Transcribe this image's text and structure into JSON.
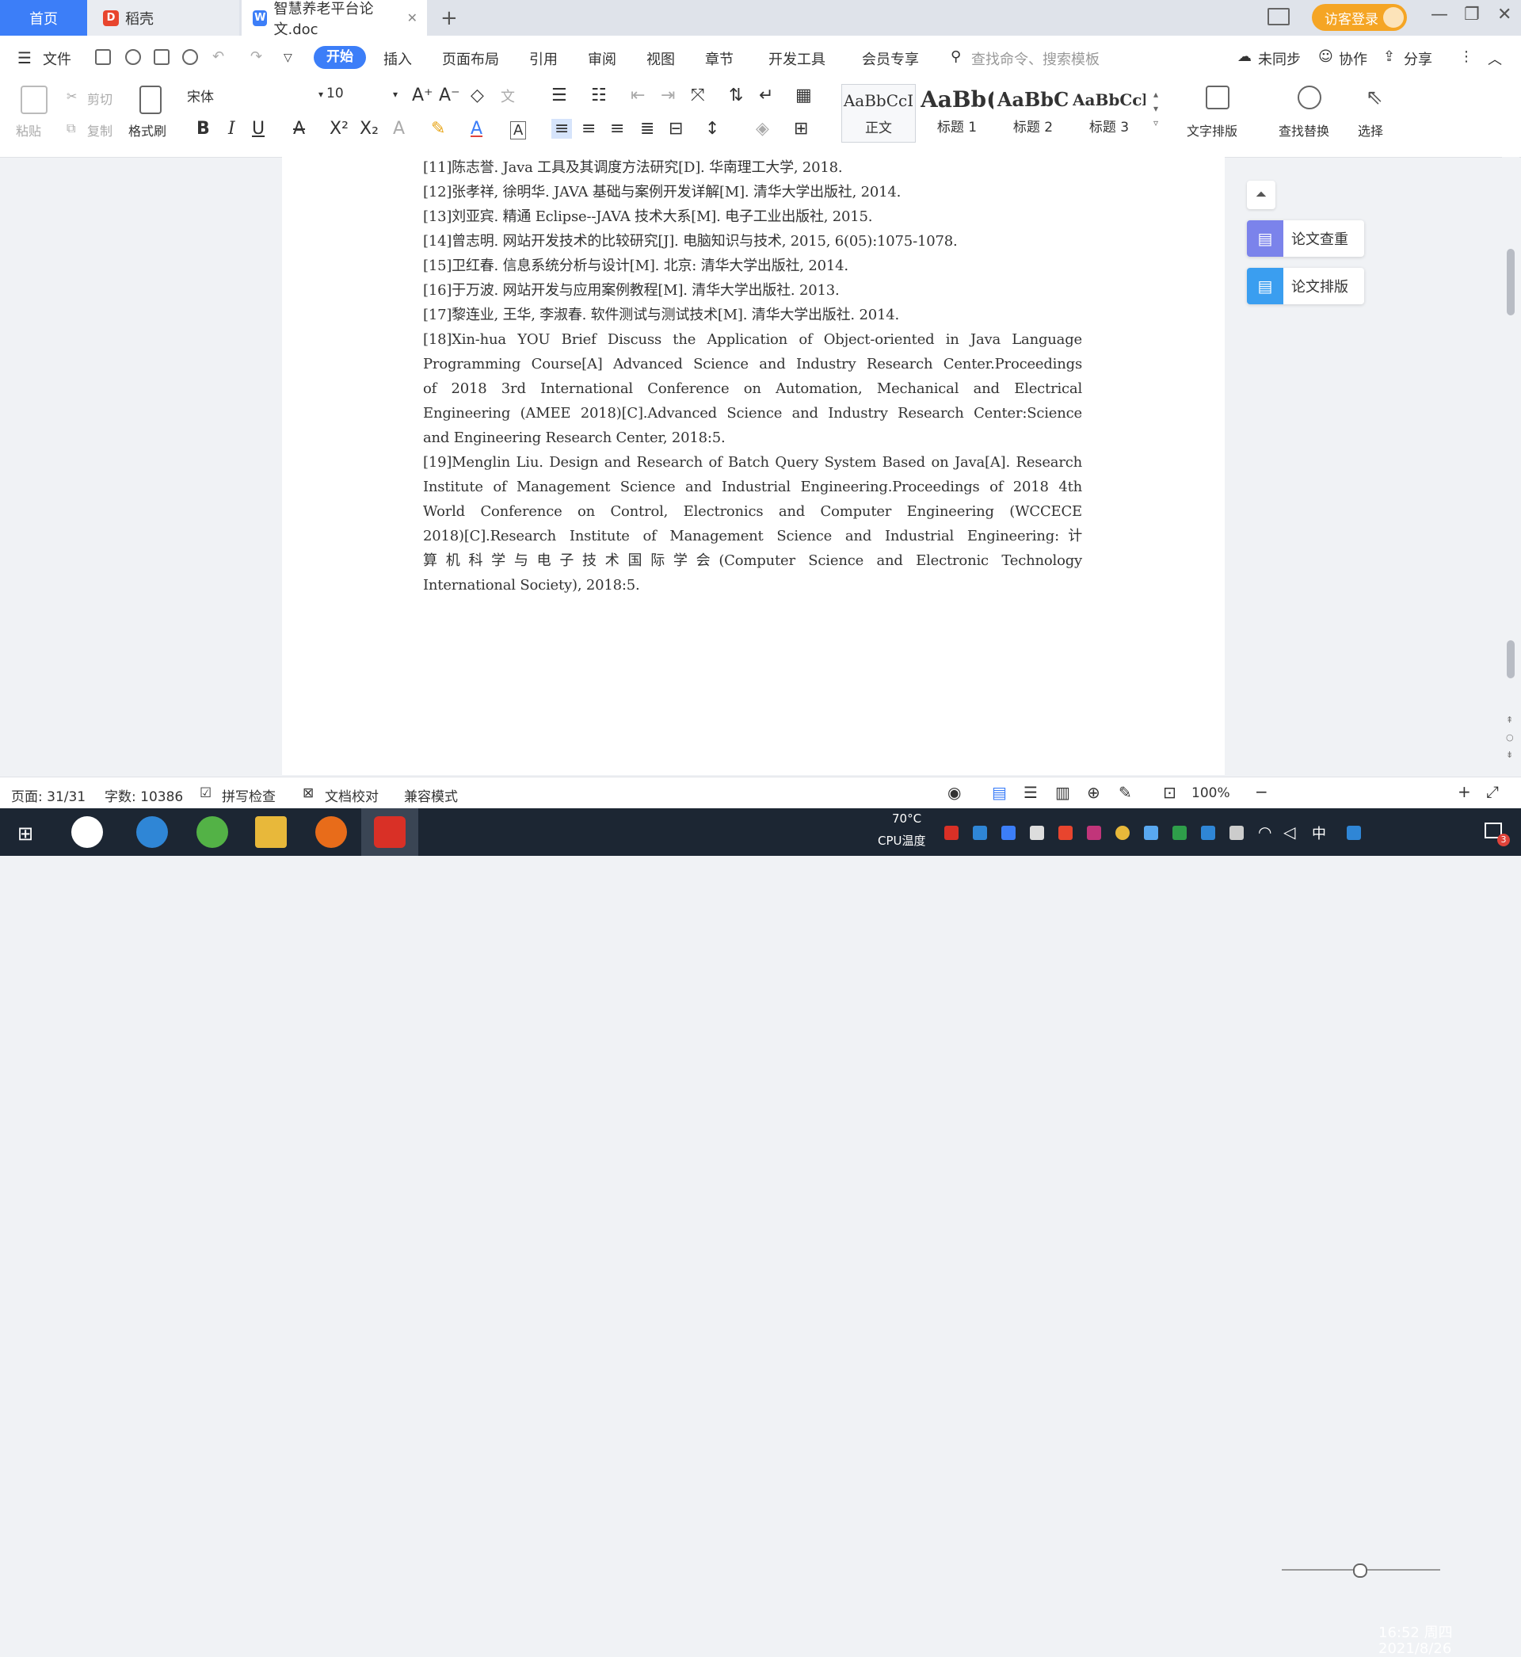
{
  "tabs": {
    "home": "首页",
    "daoke": "稻壳",
    "doc": "智慧养老平台论文.doc",
    "add": "+"
  },
  "header": {
    "visitor_login": "访客登录"
  },
  "menubar": {
    "file": "文件",
    "items": [
      "开始",
      "插入",
      "页面布局",
      "引用",
      "审阅",
      "视图",
      "章节",
      "开发工具",
      "会员专享"
    ],
    "search_placeholder": "查找命令、搜索模板",
    "unsync": "未同步",
    "collab": "协作",
    "share": "分享"
  },
  "ribbon": {
    "paste": "粘贴",
    "cut": "剪切",
    "copy": "复制",
    "format_painter": "格式刷",
    "font_name": "宋体",
    "font_size": "10",
    "styles": [
      {
        "preview": "AaBbCcI",
        "name": "正文"
      },
      {
        "preview": "AaBb(",
        "name": "标题 1"
      },
      {
        "preview": "AaBbC",
        "name": "标题 2"
      },
      {
        "preview": "AaBbCcl",
        "name": "标题 3"
      }
    ],
    "text_layout": "文字排版",
    "find_replace": "查找替换",
    "select": "选择"
  },
  "document": {
    "references": [
      "[11]陈志誉. Java 工具及其调度方法研究[D]. 华南理工大学, 2018.",
      "[12]张孝祥, 徐明华. JAVA 基础与案例开发详解[M]. 清华大学出版社, 2014.",
      "[13]刘亚宾. 精通 Eclipse--JAVA 技术大系[M]. 电子工业出版社, 2015.",
      "[14]曾志明. 网站开发技术的比较研究[J]. 电脑知识与技术, 2015, 6(05):1075-1078.",
      "[15]卫红春. 信息系统分析与设计[M]. 北京: 清华大学出版社, 2014.",
      "[16]于万波. 网站开发与应用案例教程[M]. 清华大学出版社. 2013.",
      "[17]黎连业, 王华, 李淑春. 软件测试与测试技术[M]. 清华大学出版社. 2014."
    ],
    "ref18_lines": [
      "[18]Xin-hua YOU  Brief Discuss the Application of Object-oriented in Java Language",
      "Programming Course[A]  Advanced Science and Industry Research Center.Proceedings",
      "of 2018 3rd International Conference on Automation, Mechanical and Electrical",
      "Engineering (AMEE 2018)[C].Advanced Science and Industry Research Center:Science",
      "and Engineering Research Center, 2018:5."
    ],
    "ref19_lines": [
      "[19]Menglin Liu. Design and Research of Batch Query System Based on Java[A]. Research",
      "Institute of Management Science and Industrial Engineering.Proceedings of 2018 4th",
      "World Conference on Control, Electronics and Computer Engineering (WCCECE",
      "2018)[C].Research Institute of Management Science and Industrial Engineering:计",
      "算机科学与电子技术国际学会(Computer Science and Electronic Technology",
      "International Society), 2018:5."
    ]
  },
  "side_panel": {
    "check": "论文查重",
    "layout": "论文排版"
  },
  "statusbar": {
    "page": "页面: 31/31",
    "words": "字数: 10386",
    "spellcheck": "拼写检查",
    "doc_proof": "文档校对",
    "compat": "兼容模式",
    "zoom": "100%"
  },
  "taskbar": {
    "cpu_temp": "70°C",
    "cpu_label": "CPU温度",
    "ime": "中",
    "time": "16:52 周四",
    "date": "2021/8/26",
    "notif_count": "3"
  }
}
